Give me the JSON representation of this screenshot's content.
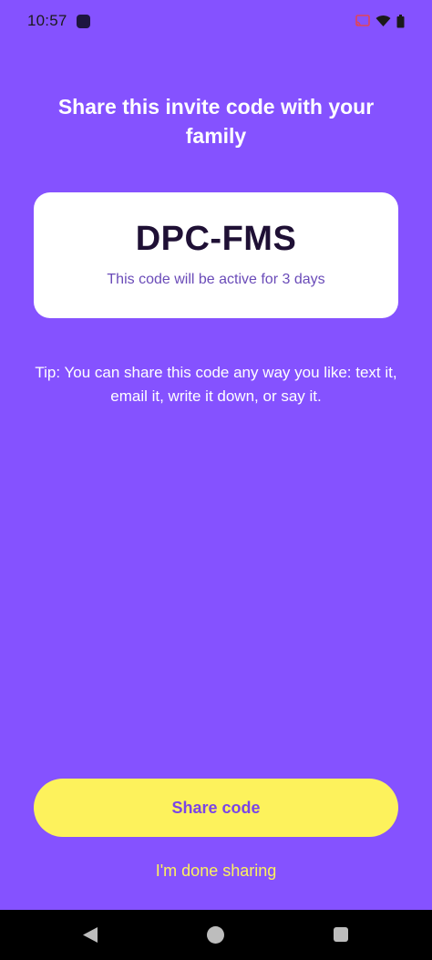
{
  "status_bar": {
    "time": "10:57",
    "icons": [
      "app-notification-icon",
      "cast-icon",
      "wifi-icon",
      "battery-icon"
    ],
    "cast_color": "#E0455A"
  },
  "invite": {
    "heading": "Share this invite code with your family",
    "code": "DPC-FMS",
    "expiry_text": "This code will be active for 3 days",
    "tip": "Tip: You can share this code any way you like: text it, email it, write it down, or say it."
  },
  "actions": {
    "share_label": "Share code",
    "done_label": "I'm done sharing"
  },
  "nav_bar": {
    "icons": [
      "back-icon",
      "home-icon",
      "recents-icon"
    ]
  },
  "colors": {
    "background": "#8552FF",
    "card": "#FFFFFF",
    "code_text": "#1F1035",
    "expiry_text": "#6A4BB8",
    "button": "#FDF25C",
    "button_text": "#7A45E6",
    "link": "#FDF25C"
  }
}
